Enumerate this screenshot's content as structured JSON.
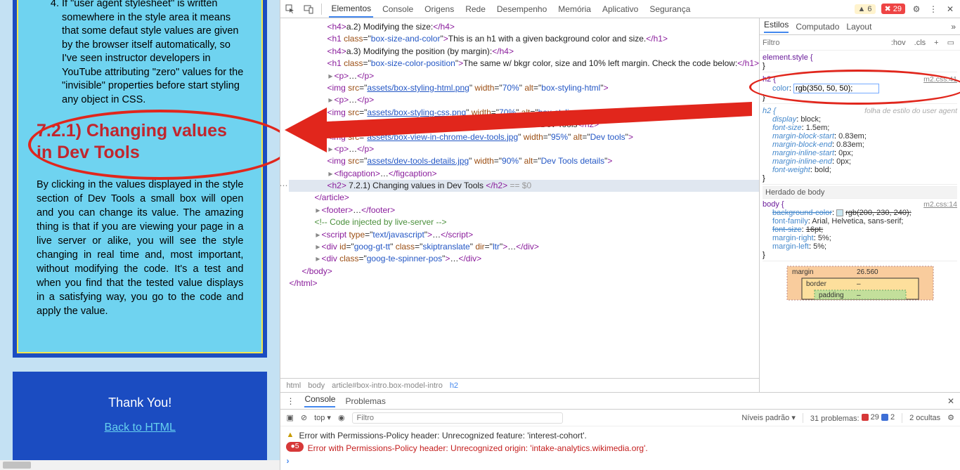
{
  "page": {
    "list_item_4": "If \"user agent stylesheet\" is written somewhere in the style area it means that some defaut style values are given by the browser itself automatically, so I've seen instructor developers in YouTube attributing \"zero\" values for the \"invisible\" properties before start styling any object in CSS.",
    "heading": "7.2.1) Changing values in Dev Tools",
    "paragraph": "By clicking in the values displayed in the style section of Dev Tools a small box will open and you can change its value. The amazing thing is that if you are viewing your page in a live server or alike, you will see the style changing in real time and, most important, without modifying the code. It's a test and when you find that the tested value displays in a satisfying way, you go to the code and apply the value.",
    "thankyou": "Thank You!",
    "back_link": "Back to HTML"
  },
  "devtools": {
    "tabs": [
      "Elementos",
      "Console",
      "Origens",
      "Rede",
      "Desempenho",
      "Memória",
      "Aplicativo",
      "Segurança"
    ],
    "warn_count": "6",
    "err_count": "29"
  },
  "dom": {
    "l1": "a.2) Modifying the size:",
    "l2_class": "box-size-and-color",
    "l2_text": "This is an h1 with a given background color and size.",
    "l3": "a.3) Modifying the position (by margin):",
    "l4_class": "box-size-color-position",
    "l4_text": "The same w/ bkgr color, size and 10% left margin. Check the code below:",
    "img1_src": "assets/box-styling-html.png",
    "img1_alt": "box-styling-html",
    "img2_src": "assets/box-styling-css.png",
    "img2_alt": "box-styling-css",
    "l5": "7.2) Viewing the CSS structure in Google Chrome's Dev Tools",
    "img3_src": "assets/box-view-in-chrome-dev-tools.jpg",
    "img3_alt": "Dev tools",
    "img4_src": "assets/dev-tools-details.jpg",
    "img4_alt": "Dev Tools details",
    "selected_tag": "h2",
    "selected_text": " 7.2.1) Changing values in Dev Tools ",
    "selected_suffix": "== $0",
    "comment": "<!-- Code injected by live-server -->",
    "div1_id": "goog-gt-tt",
    "div1_class": "skiptranslate",
    "div1_dir": "ltr",
    "div2_class": "goog-te-spinner-pos"
  },
  "crumbs": [
    "html",
    "body",
    "article#box-intro.box-model-intro",
    "h2"
  ],
  "styles": {
    "tabs": [
      "Estilos",
      "Computado",
      "Layout"
    ],
    "filter_placeholder": "Filtro",
    "hov": ":hov",
    "cls": ".cls",
    "element_style": "element.style {",
    "r1_sel": "h2 {",
    "r1_src": "m2.css:41",
    "r1_prop_name": "color",
    "r1_prop_val": "rgb(350, 50, 50);",
    "ua_label": "folha de estilo do user agent",
    "ua_sel": "h2 {",
    "ua_props": [
      {
        "n": "display",
        "v": "block;"
      },
      {
        "n": "font-size",
        "v": "1.5em;"
      },
      {
        "n": "margin-block-start",
        "v": "0.83em;"
      },
      {
        "n": "margin-block-end",
        "v": "0.83em;"
      },
      {
        "n": "margin-inline-start",
        "v": "0px;"
      },
      {
        "n": "margin-inline-end",
        "v": "0px;"
      },
      {
        "n": "font-weight",
        "v": "bold;"
      }
    ],
    "inherited_label": "Herdado de body",
    "body_sel": "body {",
    "body_src": "m2.css:14",
    "body_props": [
      {
        "n": "background-color",
        "v": "rgb(200, 230, 240);",
        "strike": true,
        "swatch": "#c8e6f0"
      },
      {
        "n": "font-family",
        "v": "Arial, Helvetica, sans-serif;"
      },
      {
        "n": "font-size",
        "v": "16pt;",
        "strike": true
      },
      {
        "n": "margin-right",
        "v": "5%;"
      },
      {
        "n": "margin-left",
        "v": "5%;"
      }
    ],
    "margin_label": "margin",
    "margin_top_val": "26.560",
    "border_label": "border",
    "padding_label": "padding"
  },
  "console": {
    "drawer_tabs": [
      "Console",
      "Problemas"
    ],
    "top": "top ▾",
    "filter_placeholder": "Filtro",
    "levels": "Níveis padrão ▾",
    "problems_label": "31 problemas:",
    "prob_err": "29",
    "prob_info": "2",
    "hidden": "2 ocultas",
    "msg1": "Error with Permissions-Policy header: Unrecognized feature: 'interest-cohort'.",
    "msg2_count": "5",
    "msg2": "Error with Permissions-Policy header: Unrecognized origin: 'intake-analytics.wikimedia.org'."
  }
}
